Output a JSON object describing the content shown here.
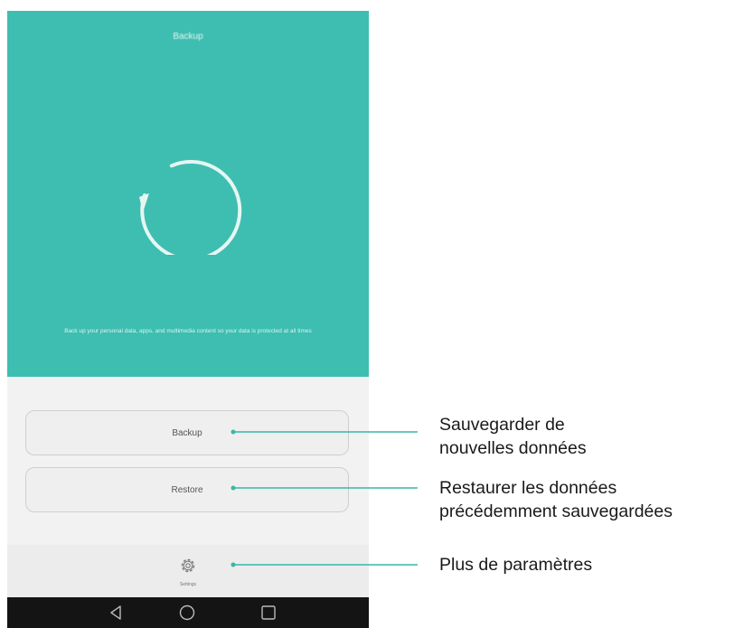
{
  "colors": {
    "teal": "#3dbeb0",
    "ring": "#e6f6f3",
    "leader": "#3ab6a9",
    "nav_bar": "#141414"
  },
  "header": {
    "title": "Backup"
  },
  "hero": {
    "icon": "refresh-ring-icon",
    "description": "Back up your personal data, apps, and multimedia content so your data is protected at all times"
  },
  "actions": {
    "backup_label": "Backup",
    "restore_label": "Restore"
  },
  "settings": {
    "icon": "gear-icon",
    "label": "Settings"
  },
  "navbar": {
    "icons": [
      "back-triangle-icon",
      "home-circle-icon",
      "recents-square-icon"
    ]
  },
  "callouts": {
    "backup_line1": "Sauvegarder de",
    "backup_line2": "nouvelles données",
    "restore_line1": "Restaurer les données",
    "restore_line2": "précédemment sauvegardées",
    "settings": "Plus de paramètres"
  }
}
